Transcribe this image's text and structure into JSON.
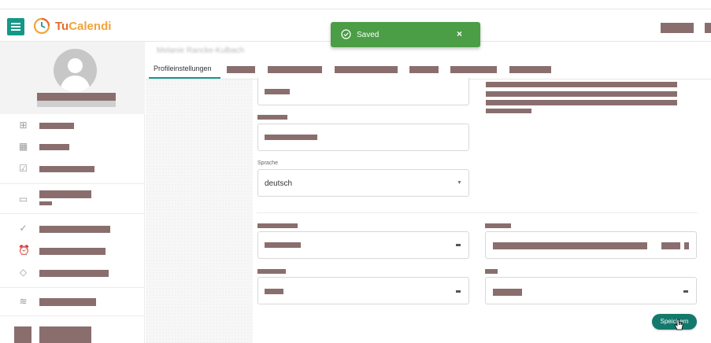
{
  "app": {
    "brand_part1": "Tu",
    "brand_part2": "Calendi",
    "brand_colors": {
      "primary": "#159788",
      "logo_orange": "#e66a2c",
      "logo_yellow": "#f2a33a"
    }
  },
  "toast": {
    "message": "Saved",
    "close_symbol": "×",
    "color": "#4b9d46",
    "icon": "check-circle-icon"
  },
  "header": {
    "user_name": "Melanie Rancke-Kulbach",
    "active_tab": "Profileinstellungen"
  },
  "sidebar": {
    "icons": [
      "grid-icon",
      "calendar-icon",
      "calendar-check-icon",
      "window-icon",
      "double-check-icon",
      "alarm-clock-icon",
      "eraser-icon",
      "layers-icon"
    ]
  },
  "form": {
    "language_label": "Sprache",
    "language_value": "deutsch"
  },
  "actions": {
    "save_label": "Speichern"
  }
}
